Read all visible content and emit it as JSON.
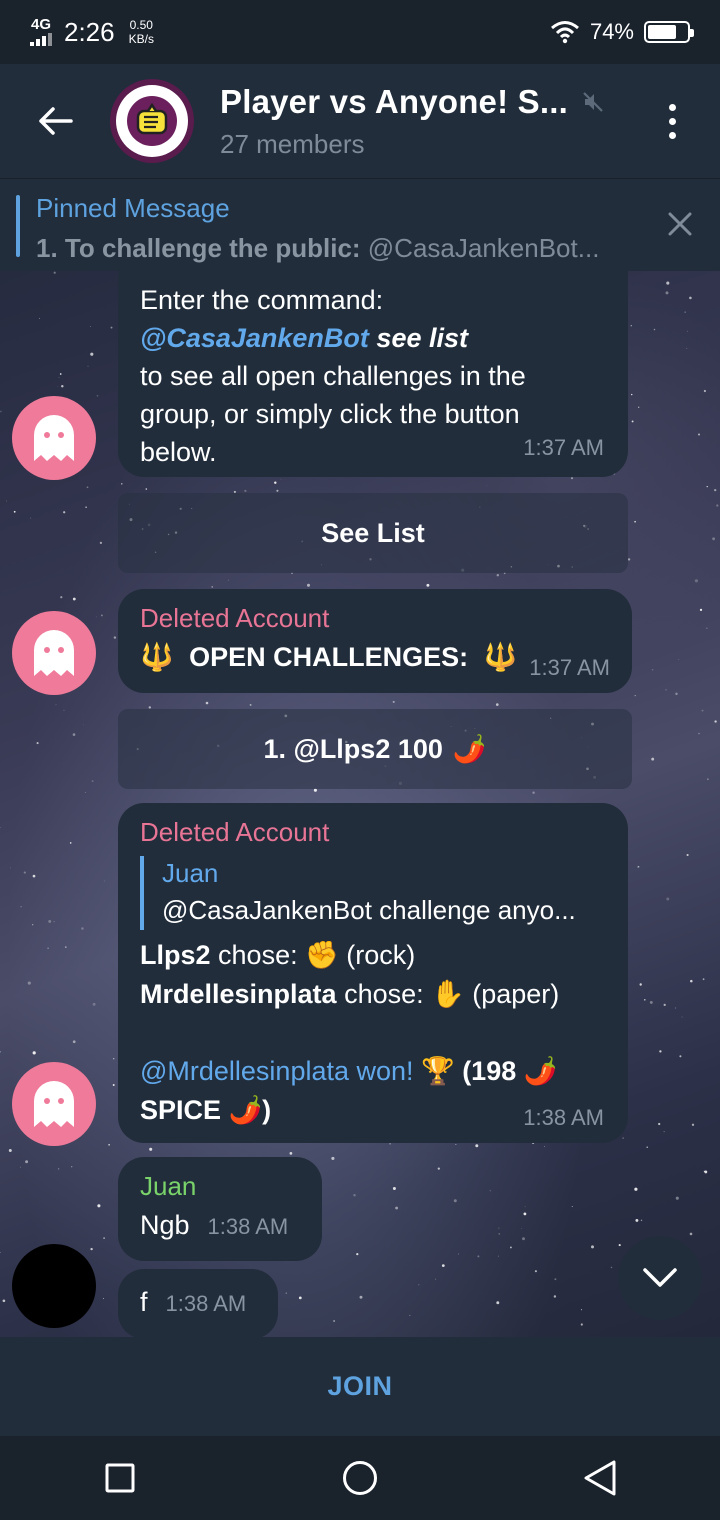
{
  "status_bar": {
    "network": "4G",
    "time": "2:26",
    "speed_value": "0.50",
    "speed_unit": "KB/s",
    "battery_percent": "74%",
    "battery_level": 0.74
  },
  "header": {
    "title": "Player vs Anyone! S...",
    "subtitle": "27 members",
    "muted": true
  },
  "pinned": {
    "title": "Pinned Message",
    "text_bold": "1. To challenge the public:",
    "text_rest": " @CasaJankenBot..."
  },
  "messages": {
    "m1": {
      "line1": "Enter the command:",
      "mention": "@CasaJankenBot",
      "command": " see list",
      "line3": "to see all open challenges in the",
      "line4": "group, or simply click the button",
      "line5": "below.",
      "time": "1:37 AM",
      "button": "See List"
    },
    "m2": {
      "sender": "Deleted Account",
      "text": "OPEN CHALLENGES:",
      "emoji": "🔱",
      "time": "1:37 AM",
      "button": "1.  @Llps2 100",
      "button_emoji": "🌶️"
    },
    "m3": {
      "sender": "Deleted Account",
      "reply_name": "Juan",
      "reply_text": "@CasaJankenBot challenge anyo...",
      "p1_name": "Llps2",
      "p1_action": " chose: ",
      "p1_emoji": "✊",
      "p1_choice": " (rock)",
      "p2_name": "Mrdellesinplata",
      "p2_action": " chose: ",
      "p2_emoji": "✋",
      "p2_choice": " (paper)",
      "winner": "@Mrdellesinplata won!",
      "trophy": "🏆",
      "prize": " (198 ",
      "chili": "🌶️",
      "spice": "SPICE ",
      "close": ")",
      "time": "1:38 AM"
    },
    "m4": {
      "sender": "Juan",
      "text": "Ngb",
      "time": "1:38 AM"
    },
    "m5": {
      "text": "f",
      "time": "1:38 AM"
    }
  },
  "join": {
    "label": "JOIN"
  },
  "icons": {
    "back": "arrow-left-icon",
    "more": "more-vert-icon",
    "mute": "mute-icon",
    "close": "close-icon",
    "scroll": "chevron-down-icon",
    "nav_recent": "square-icon",
    "nav_home": "circle-icon",
    "nav_back": "triangle-back-icon"
  },
  "colors": {
    "header_bg": "#212d3b",
    "accent": "#5ea3e0",
    "deleted_name": "#e87595",
    "juan_name": "#7ad36a"
  }
}
